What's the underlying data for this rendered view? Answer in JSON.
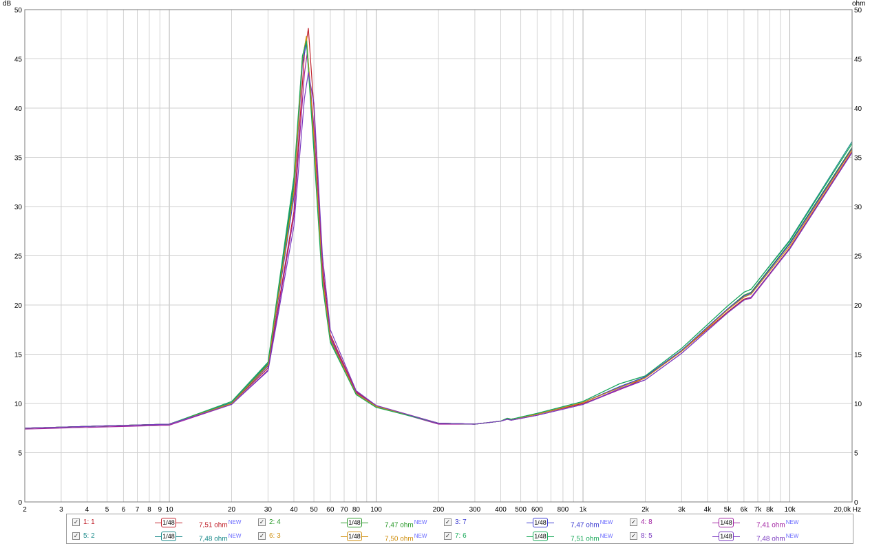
{
  "chart_data": {
    "type": "line",
    "xscale": "log",
    "xlim": [
      2,
      20000
    ],
    "ylim": [
      0,
      50
    ],
    "xunit": "Hz",
    "yunit_left": "dB",
    "yunit_right": "ohm",
    "grid": true,
    "legend": "bottom",
    "yticks": [
      "0",
      "5",
      "10",
      "15",
      "20",
      "25",
      "30",
      "35",
      "40",
      "45",
      "50"
    ],
    "xticks": [
      {
        "v": 2,
        "label": "2"
      },
      {
        "v": 3,
        "label": "3"
      },
      {
        "v": 4,
        "label": "4"
      },
      {
        "v": 5,
        "label": "5"
      },
      {
        "v": 6,
        "label": "6"
      },
      {
        "v": 7,
        "label": "7"
      },
      {
        "v": 8,
        "label": "8"
      },
      {
        "v": 9,
        "label": "9"
      },
      {
        "v": 10,
        "label": "10"
      },
      {
        "v": 20,
        "label": "20"
      },
      {
        "v": 30,
        "label": "30"
      },
      {
        "v": 40,
        "label": "40"
      },
      {
        "v": 50,
        "label": "50"
      },
      {
        "v": 60,
        "label": "60"
      },
      {
        "v": 70,
        "label": "70"
      },
      {
        "v": 80,
        "label": "80"
      },
      {
        "v": 100,
        "label": "100"
      },
      {
        "v": 200,
        "label": "200"
      },
      {
        "v": 300,
        "label": "300"
      },
      {
        "v": 400,
        "label": "400"
      },
      {
        "v": 500,
        "label": "500"
      },
      {
        "v": 600,
        "label": "600"
      },
      {
        "v": 800,
        "label": "800"
      },
      {
        "v": 1000,
        "label": "1k"
      },
      {
        "v": 2000,
        "label": "2k"
      },
      {
        "v": 3000,
        "label": "3k"
      },
      {
        "v": 4000,
        "label": "4k"
      },
      {
        "v": 5000,
        "label": "5k"
      },
      {
        "v": 6000,
        "label": "6k"
      },
      {
        "v": 7000,
        "label": "7k"
      },
      {
        "v": 8000,
        "label": "8k"
      },
      {
        "v": 10000,
        "label": "10k"
      },
      {
        "v": 20000,
        "label": "20,0k Hz"
      }
    ],
    "series": [
      {
        "name": "1: 1",
        "color": "#c0202a",
        "smoothing": "1/48",
        "value": "7,51 ohm",
        "x": [
          2,
          10,
          20,
          30,
          40,
          45,
          47,
          50,
          55,
          60,
          80,
          100,
          200,
          300,
          400,
          430,
          450,
          600,
          1000,
          1500,
          2000,
          3000,
          5000,
          6000,
          6500,
          10000,
          20000
        ],
        "y": [
          7.5,
          7.9,
          10.0,
          13.6,
          29.5,
          45.5,
          48.1,
          40.0,
          24.0,
          17.0,
          11.2,
          9.8,
          8.0,
          7.9,
          8.2,
          8.4,
          8.4,
          8.9,
          10.0,
          11.4,
          12.6,
          15.3,
          19.3,
          20.6,
          20.8,
          25.8,
          35.6
        ]
      },
      {
        "name": "2: 4",
        "color": "#2a9a2a",
        "smoothing": "1/48",
        "value": "7,47 ohm",
        "x": [
          2,
          10,
          20,
          30,
          40,
          44,
          46,
          50,
          55,
          60,
          80,
          100,
          200,
          300,
          400,
          430,
          450,
          600,
          1000,
          1500,
          2000,
          3000,
          5000,
          6000,
          6500,
          10000,
          20000
        ],
        "y": [
          7.5,
          7.9,
          10.1,
          14.0,
          32.0,
          45.0,
          47.2,
          36.5,
          22.5,
          16.4,
          11.0,
          9.7,
          8.0,
          7.9,
          8.2,
          8.5,
          8.4,
          8.9,
          10.1,
          11.7,
          12.7,
          15.4,
          19.6,
          21.0,
          21.3,
          26.3,
          36.0
        ]
      },
      {
        "name": "3: 7",
        "color": "#3a3ad0",
        "smoothing": "1/48",
        "value": "7,47 ohm",
        "x": [
          2,
          10,
          20,
          30,
          40,
          44,
          46,
          50,
          55,
          60,
          80,
          100,
          200,
          300,
          400,
          430,
          450,
          600,
          1000,
          1500,
          2000,
          3000,
          5000,
          6000,
          6500,
          10000,
          20000
        ],
        "y": [
          7.5,
          7.9,
          10.0,
          13.8,
          31.0,
          44.5,
          46.6,
          37.5,
          23.0,
          16.6,
          11.1,
          9.7,
          8.0,
          7.9,
          8.2,
          8.5,
          8.4,
          8.9,
          10.1,
          11.7,
          12.7,
          15.4,
          19.6,
          20.9,
          21.2,
          26.2,
          35.9
        ]
      },
      {
        "name": "4: 8",
        "color": "#a020a0",
        "smoothing": "1/48",
        "value": "7,41 ohm",
        "x": [
          2,
          10,
          20,
          30,
          40,
          45,
          46.5,
          50,
          55,
          60,
          80,
          100,
          200,
          300,
          400,
          430,
          450,
          600,
          1000,
          1500,
          2000,
          3000,
          5000,
          6000,
          6500,
          10000,
          20000
        ],
        "y": [
          7.4,
          7.8,
          9.9,
          13.4,
          29.0,
          43.5,
          45.7,
          38.0,
          23.5,
          16.8,
          11.1,
          9.7,
          7.9,
          7.9,
          8.2,
          8.4,
          8.3,
          8.8,
          9.9,
          11.4,
          12.4,
          15.1,
          19.2,
          20.5,
          20.7,
          25.7,
          35.5
        ]
      },
      {
        "name": "5: 2",
        "color": "#1a8a8a",
        "smoothing": "1/48",
        "value": "7,48 ohm",
        "x": [
          2,
          10,
          20,
          30,
          40,
          44,
          46,
          50,
          55,
          60,
          80,
          100,
          200,
          300,
          400,
          430,
          450,
          600,
          1000,
          1500,
          2000,
          3000,
          5000,
          6000,
          6500,
          10000,
          20000
        ],
        "y": [
          7.5,
          7.9,
          10.1,
          14.1,
          32.5,
          45.2,
          47.0,
          36.0,
          22.3,
          16.3,
          11.0,
          9.7,
          8.0,
          7.9,
          8.2,
          8.5,
          8.4,
          9.0,
          10.2,
          12.0,
          12.8,
          15.6,
          19.9,
          21.3,
          21.6,
          26.6,
          36.6
        ]
      },
      {
        "name": "6: 3",
        "color": "#d09010",
        "smoothing": "1/48",
        "value": "7,50 ohm",
        "x": [
          2,
          10,
          20,
          30,
          40,
          44,
          46,
          50,
          55,
          60,
          80,
          100,
          200,
          300,
          400,
          430,
          450,
          600,
          1000,
          1500,
          2000,
          3000,
          5000,
          6000,
          6500,
          10000,
          20000
        ],
        "y": [
          7.5,
          7.9,
          10.0,
          13.9,
          31.5,
          45.0,
          47.3,
          37.0,
          22.8,
          16.5,
          11.0,
          9.7,
          8.0,
          7.9,
          8.2,
          8.5,
          8.4,
          8.9,
          10.1,
          11.6,
          12.6,
          15.3,
          19.5,
          20.8,
          21.1,
          26.0,
          35.8
        ]
      },
      {
        "name": "7: 6",
        "color": "#1aaa5a",
        "smoothing": "1/48",
        "value": "7,51 ohm",
        "x": [
          2,
          10,
          20,
          30,
          40,
          44,
          46,
          50,
          55,
          60,
          80,
          100,
          200,
          300,
          400,
          430,
          450,
          600,
          1000,
          1500,
          2000,
          3000,
          5000,
          6000,
          6500,
          10000,
          20000
        ],
        "y": [
          7.5,
          7.9,
          10.2,
          14.2,
          33.0,
          45.3,
          46.8,
          35.5,
          22.0,
          16.2,
          10.9,
          9.6,
          8.0,
          7.9,
          8.2,
          8.5,
          8.4,
          9.0,
          10.2,
          12.0,
          12.8,
          15.6,
          19.9,
          21.3,
          21.6,
          26.5,
          36.4
        ]
      },
      {
        "name": "8: 5",
        "color": "#7a3ac0",
        "smoothing": "1/48",
        "value": "7,48 ohm",
        "x": [
          2,
          10,
          20,
          30,
          40,
          45,
          47,
          50,
          55,
          60,
          80,
          100,
          200,
          300,
          400,
          430,
          450,
          600,
          1000,
          1500,
          2000,
          3000,
          5000,
          6000,
          6500,
          10000,
          20000
        ],
        "y": [
          7.5,
          7.9,
          9.9,
          13.3,
          28.0,
          41.0,
          43.6,
          40.5,
          25.0,
          17.5,
          11.3,
          9.8,
          8.0,
          7.9,
          8.2,
          8.4,
          8.3,
          8.8,
          9.9,
          11.5,
          12.4,
          15.1,
          19.2,
          20.5,
          20.8,
          25.7,
          35.5
        ]
      }
    ]
  },
  "legend": {
    "new_badge": "NEW"
  }
}
